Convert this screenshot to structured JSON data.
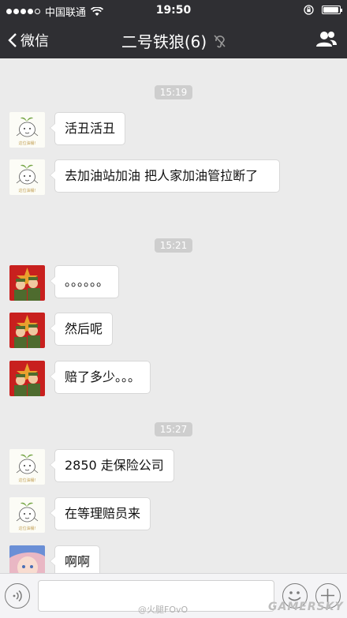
{
  "status_bar": {
    "carrier": "中国联通",
    "time": "19:50",
    "signal_icon": "signal-dots-icon",
    "wifi_icon": "wifi-icon",
    "orientation_icon": "rotation-lock-icon",
    "battery_icon": "battery-icon",
    "battery_level": 0.95
  },
  "nav": {
    "back_label": "微信",
    "title": "二号铁狼(6)",
    "mute_icon": "mute-ear-icon",
    "contacts_icon": "group-members-icon"
  },
  "messages": [
    {
      "type": "time",
      "text": "15:19"
    },
    {
      "type": "msg",
      "avatar": "sprout-avatar",
      "text": "活丑活丑"
    },
    {
      "type": "msg",
      "avatar": "sprout-avatar",
      "text": "去加油站加油  把人家加油管拉断了"
    },
    {
      "type": "time",
      "text": "15:21"
    },
    {
      "type": "msg",
      "avatar": "soldier-avatar",
      "text": "。。。。。。"
    },
    {
      "type": "msg",
      "avatar": "soldier-avatar",
      "text": "然后呢"
    },
    {
      "type": "msg",
      "avatar": "soldier-avatar",
      "text": "赔了多少。。。"
    },
    {
      "type": "time",
      "text": "15:27"
    },
    {
      "type": "msg",
      "avatar": "sprout-avatar",
      "text": "2850  走保险公司"
    },
    {
      "type": "msg",
      "avatar": "sprout-avatar",
      "text": "在等理赔员来"
    },
    {
      "type": "msg",
      "avatar": "anime-avatar",
      "text": "啊啊"
    }
  ],
  "avatars": {
    "sprout_caption": "这位油桶!"
  },
  "input_bar": {
    "voice_icon": "voice-icon",
    "emoji_icon": "emoji-icon",
    "plus_icon": "plus-icon",
    "input_value": ""
  },
  "watermark": {
    "weibo": "@火腿FOvO",
    "site": "GAMERSKY"
  },
  "colors": {
    "nav_bg": "#2f2f33",
    "chat_bg": "#ebebeb",
    "bubble_bg": "#ffffff",
    "timestamp_bg": "#cecece"
  }
}
